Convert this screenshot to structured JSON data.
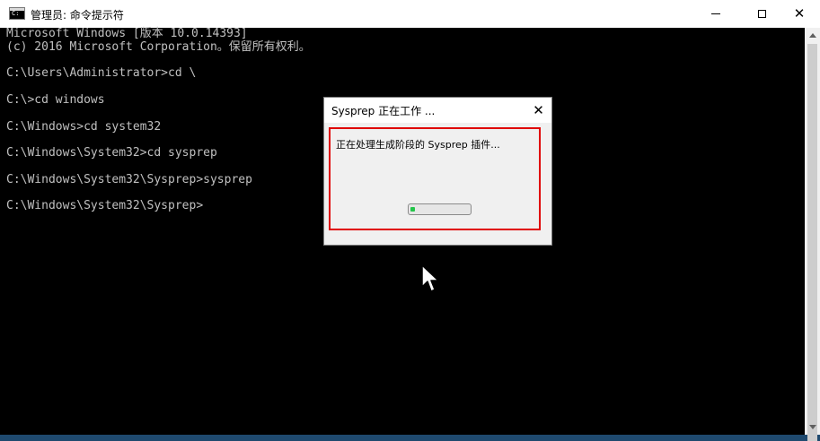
{
  "window": {
    "title": "管理员: 命令提示符",
    "controls": {
      "minimize": "minimize",
      "maximize": "maximize",
      "close": "✕"
    }
  },
  "console": {
    "lines": [
      "Microsoft Windows [版本 10.0.14393]",
      "(c) 2016 Microsoft Corporation。保留所有权利。",
      "",
      "C:\\Users\\Administrator>cd \\",
      "",
      "C:\\>cd windows",
      "",
      "C:\\Windows>cd system32",
      "",
      "C:\\Windows\\System32>cd sysprep",
      "",
      "C:\\Windows\\System32\\Sysprep>sysprep",
      "",
      "C:\\Windows\\System32\\Sysprep>"
    ]
  },
  "dialog": {
    "title": "Sysprep 正在工作 ...",
    "close": "✕",
    "message": "正在处理生成阶段的 Sysprep 插件...",
    "progress": 0.08,
    "highlight_color": "#e00000"
  },
  "icons": {
    "app": "cmd-icon",
    "cursor": "arrow-cursor"
  }
}
